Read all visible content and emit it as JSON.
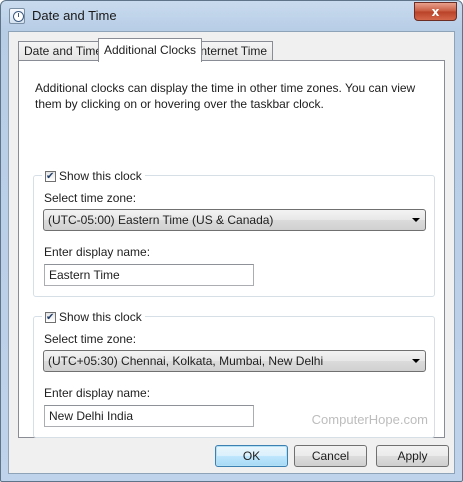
{
  "window": {
    "title": "Date and Time",
    "close_glyph": "x"
  },
  "tabs": [
    {
      "label": "Date and Time",
      "active": false
    },
    {
      "label": "Additional Clocks",
      "active": true
    },
    {
      "label": "Internet Time",
      "active": false
    }
  ],
  "intro_text": "Additional clocks can display the time in other time zones. You can view them by clicking on or hovering over the taskbar clock.",
  "clocks": [
    {
      "show_label": "Show this clock",
      "checked": true,
      "timezone_label": "Select time zone:",
      "timezone_value": "(UTC-05:00) Eastern Time (US & Canada)",
      "display_name_label": "Enter display name:",
      "display_name_value": "Eastern Time"
    },
    {
      "show_label": "Show this clock",
      "checked": true,
      "timezone_label": "Select time zone:",
      "timezone_value": "(UTC+05:30) Chennai, Kolkata, Mumbai, New Delhi",
      "display_name_label": "Enter display name:",
      "display_name_value": "New Delhi India"
    }
  ],
  "watermark": "ComputerHope.com",
  "buttons": {
    "ok": "OK",
    "cancel": "Cancel",
    "apply": "Apply"
  },
  "colors": {
    "close_button": "#c75a3f",
    "default_button_border": "#3c7fb1",
    "title_bar": "#c9dbee"
  }
}
